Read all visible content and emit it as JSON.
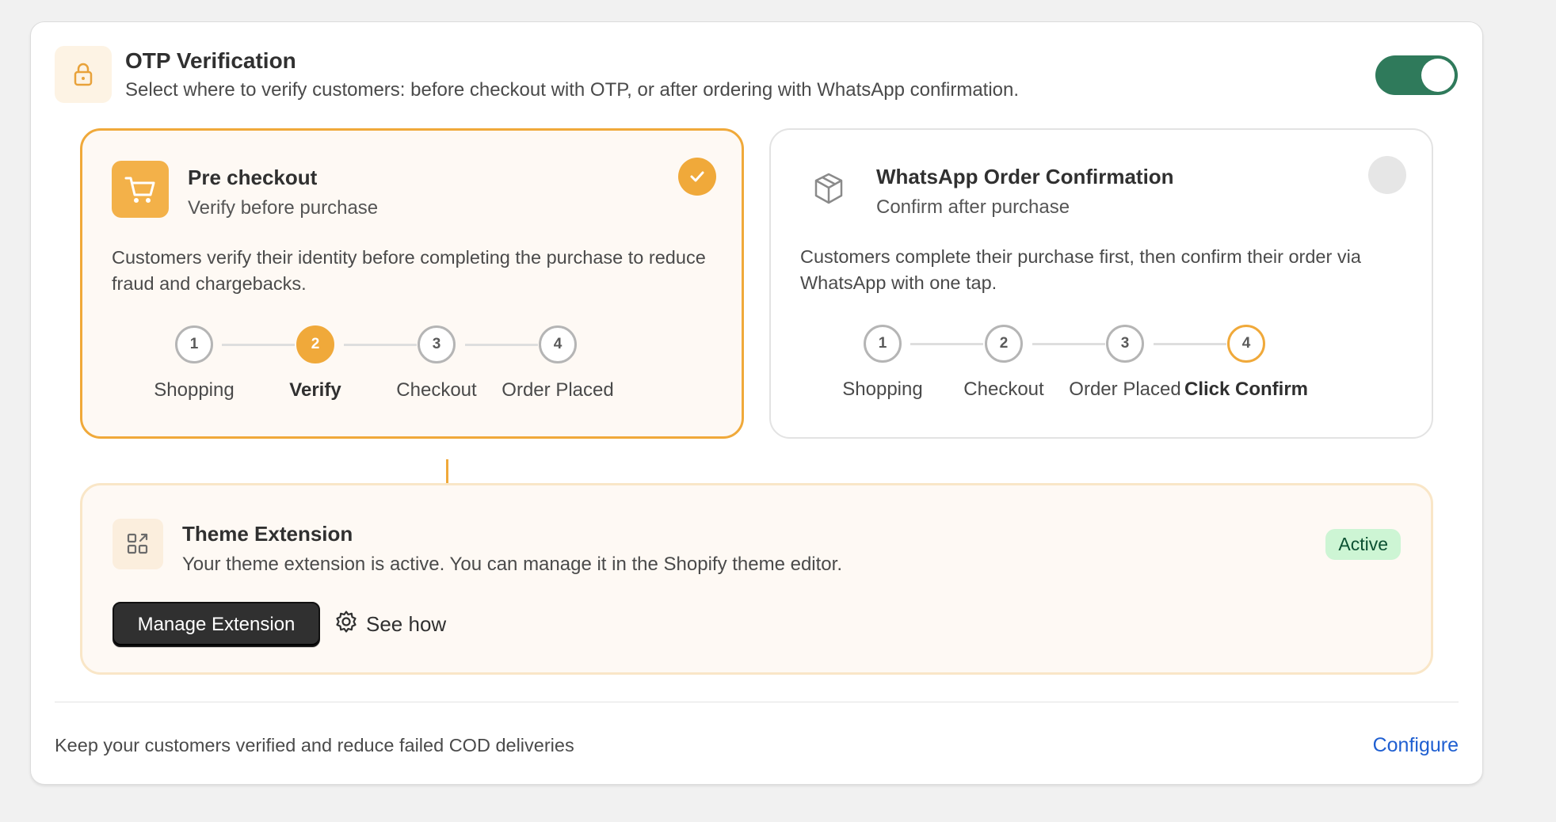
{
  "header": {
    "icon": "lock-icon",
    "title": "OTP Verification",
    "description": "Select where to verify customers: before checkout with OTP, or after ordering with WhatsApp confirmation.",
    "toggle_on": true
  },
  "options": {
    "pre_checkout": {
      "icon": "cart-icon",
      "title": "Pre checkout",
      "subtitle": "Verify before purchase",
      "description": "Customers verify their identity before completing the purchase to reduce fraud and chargebacks.",
      "selected": true,
      "steps": [
        {
          "num": "1",
          "label": "Shopping"
        },
        {
          "num": "2",
          "label": "Verify"
        },
        {
          "num": "3",
          "label": "Checkout"
        },
        {
          "num": "4",
          "label": "Order Placed"
        }
      ]
    },
    "whatsapp": {
      "icon": "package-icon",
      "title": "WhatsApp Order Confirmation",
      "subtitle": "Confirm after purchase",
      "description": "Customers complete their purchase first, then confirm their order via WhatsApp with one tap.",
      "selected": false,
      "steps": [
        {
          "num": "1",
          "label": "Shopping"
        },
        {
          "num": "2",
          "label": "Checkout"
        },
        {
          "num": "3",
          "label": "Order Placed"
        },
        {
          "num": "4",
          "label": "Click Confirm"
        }
      ]
    }
  },
  "extension": {
    "icon": "apps-icon",
    "title": "Theme Extension",
    "description": "Your theme extension is active. You can manage it in the Shopify theme editor.",
    "status": "Active",
    "manage_label": "Manage Extension",
    "see_how_label": "See how"
  },
  "footer": {
    "text": "Keep your customers verified and reduce failed COD deliveries",
    "link": "Configure"
  },
  "colors": {
    "accent": "#f0a93a",
    "toggle": "#2f7a5b",
    "link": "#1f5fd1",
    "badge_bg": "#cdf5d4"
  }
}
